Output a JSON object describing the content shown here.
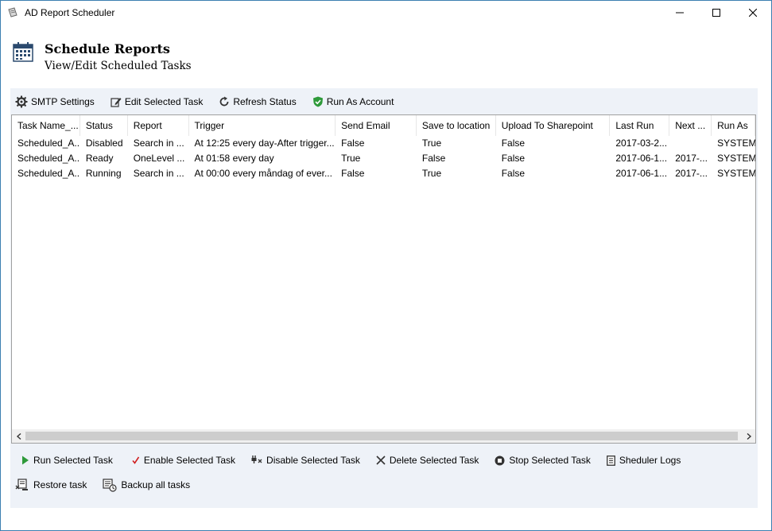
{
  "window": {
    "title": "AD Report Scheduler"
  },
  "header": {
    "title": "Schedule Reports",
    "subtitle": "View/Edit Scheduled Tasks"
  },
  "toolbar": {
    "smtp_label": "SMTP Settings",
    "edit_label": "Edit Selected Task",
    "refresh_label": "Refresh Status",
    "runas_label": "Run As Account"
  },
  "table": {
    "columns": [
      "Task Name_...",
      "Status",
      "Report",
      "Trigger",
      "Send Email",
      "Save to location",
      "Upload To Sharepoint",
      "Last Run",
      "Next ...",
      "Run As"
    ],
    "rows": [
      [
        "Scheduled_A...",
        "Disabled",
        "Search in ...",
        "At 12:25 every day-After trigger...",
        "False",
        "True",
        "False",
        "2017-03-2...",
        "",
        "SYSTEM"
      ],
      [
        "Scheduled_A...",
        "Ready",
        "OneLevel ...",
        "At 01:58 every day",
        "True",
        "False",
        "False",
        "2017-06-1...",
        "2017-...",
        "SYSTEM"
      ],
      [
        "Scheduled_A...",
        "Running",
        "Search in ...",
        "At 00:00 every måndag of ever...",
        "False",
        "True",
        "False",
        "2017-06-1...",
        "2017-...",
        "SYSTEM"
      ]
    ]
  },
  "actions": {
    "run_label": "Run Selected Task",
    "enable_label": "Enable Selected Task",
    "disable_label": "Disable Selected Task",
    "delete_label": "Delete Selected Task",
    "stop_label": "Stop Selected Task",
    "logs_label": "Sheduler Logs",
    "restore_label": "Restore task",
    "backup_label": "Backup all tasks"
  },
  "colors": {
    "run_icon": "#2e9a3a",
    "enable_icon": "#d02020",
    "runas_shield": "#2e9a3a",
    "panel_bg": "#eef2f8"
  }
}
